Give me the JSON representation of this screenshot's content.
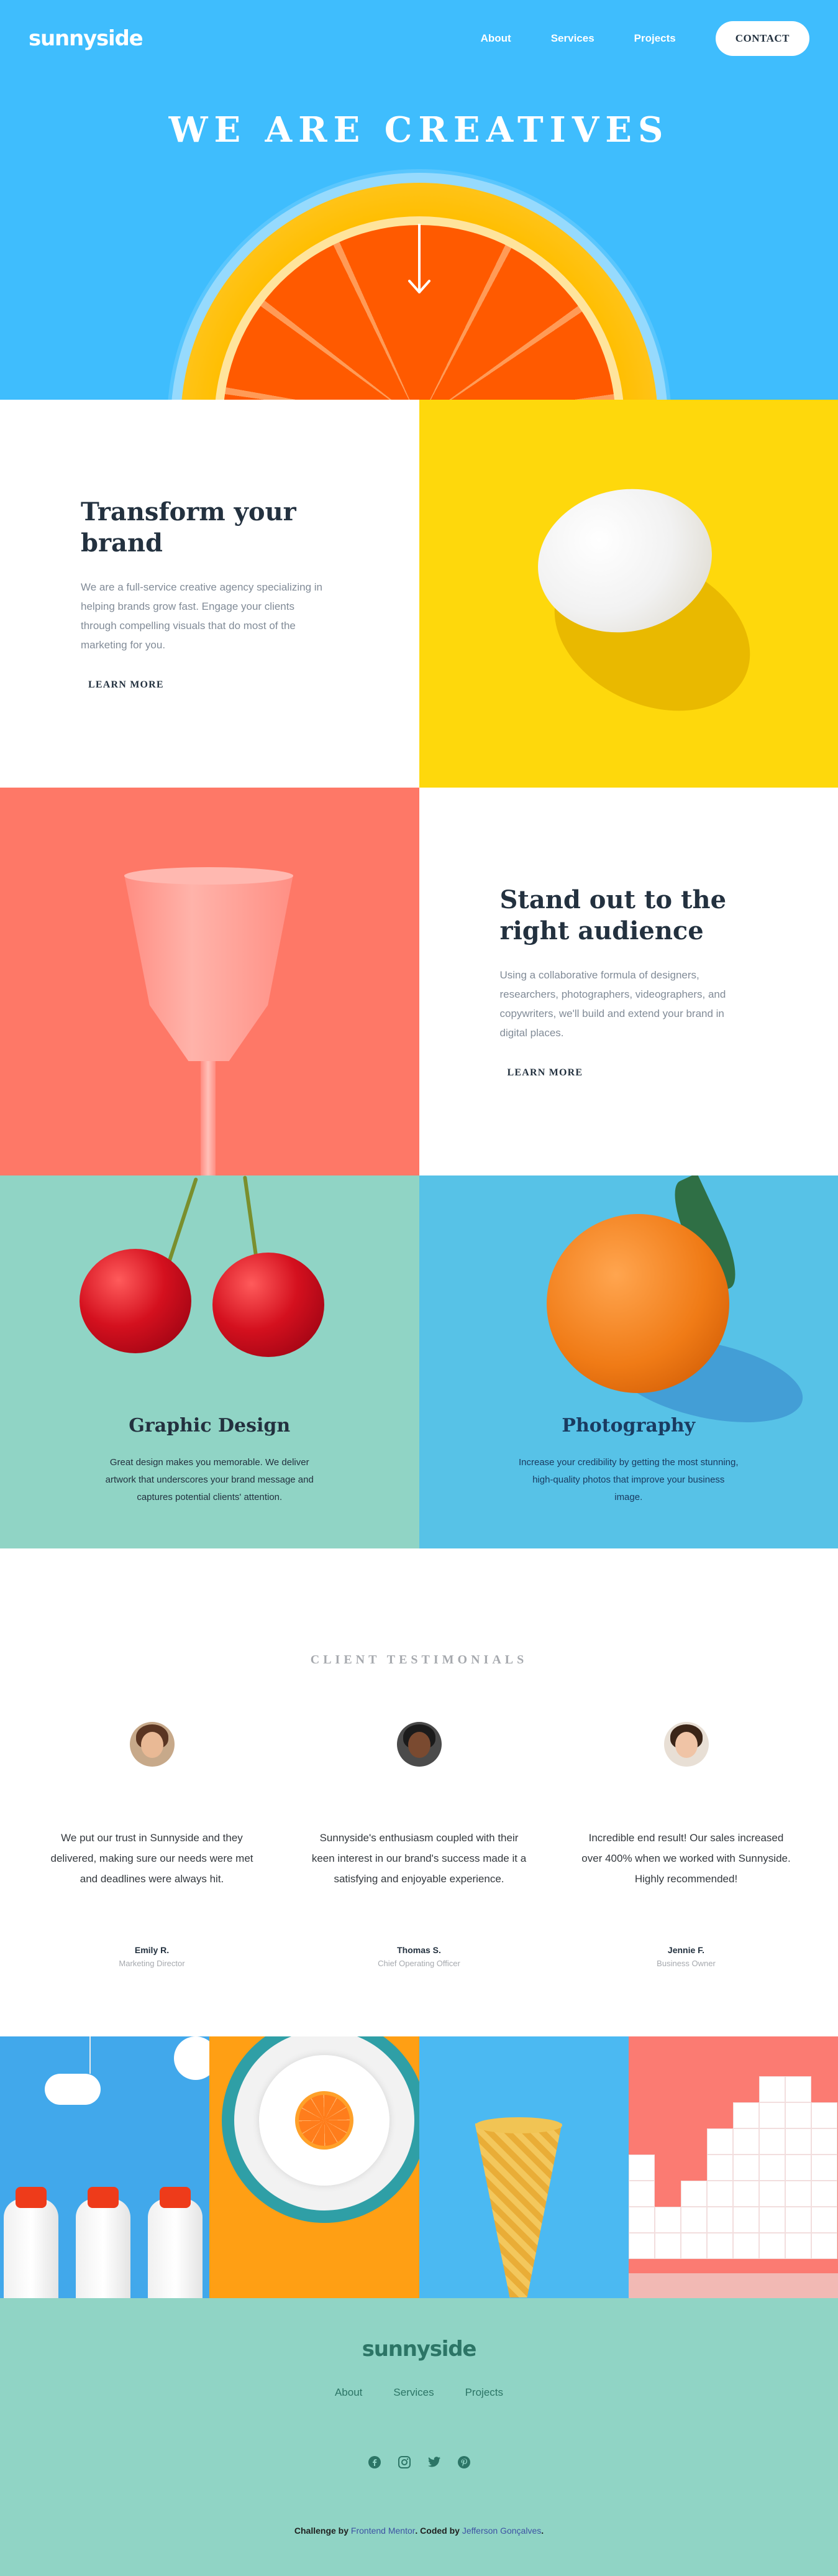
{
  "header": {
    "logo": "sunnyside",
    "nav": [
      "About",
      "Services",
      "Projects"
    ],
    "cta": "CONTACT"
  },
  "hero": {
    "title": "WE ARE CREATIVES",
    "scroll_icon": "arrow-down-icon"
  },
  "features": [
    {
      "title": "Transform your brand",
      "body": "We are a full-service creative agency specializing in helping brands grow fast. Engage your clients through compelling visuals that do most of the marketing for you.",
      "link": "LEARN MORE",
      "accent": "#fad400"
    },
    {
      "title": "Stand out to the right audience",
      "body": "Using a collaborative formula of designers, researchers, photographers, videographers, and copywriters, we'll build and extend your brand in digital places.",
      "link": "LEARN MORE",
      "accent": "#fe7a6c"
    }
  ],
  "services": [
    {
      "title": "Graphic Design",
      "body": "Great design makes you memorable. We deliver artwork that underscores your brand message and captures potential clients' attention."
    },
    {
      "title": "Photography",
      "body": "Increase your credibility by getting the most stunning, high-quality photos that improve your business image."
    }
  ],
  "testimonials": {
    "heading": "CLIENT TESTIMONIALS",
    "items": [
      {
        "quote": "We put our trust in Sunnyside and they delivered, making sure our needs were met and deadlines were always hit.",
        "name": "Emily R.",
        "role": "Marketing Director"
      },
      {
        "quote": "Sunnyside's enthusiasm coupled with their keen interest in our brand's success made it a satisfying and enjoyable experience.",
        "name": "Thomas S.",
        "role": "Chief Operating Officer"
      },
      {
        "quote": "Incredible end result! Our sales increased over 400% when we worked with Sunnyside. Highly recommended!",
        "name": "Jennie F.",
        "role": "Business Owner"
      }
    ]
  },
  "footer": {
    "logo": "sunnyside",
    "nav": [
      "About",
      "Services",
      "Projects"
    ],
    "socials": [
      "facebook-icon",
      "instagram-icon",
      "twitter-icon",
      "pinterest-icon"
    ],
    "attribution": {
      "challenge_label": "Challenge by",
      "challenge_link": "Frontend Mentor",
      "coded_label": ". Coded by",
      "coded_link": "Jefferson Gonçalves",
      "end": "."
    }
  },
  "colors": {
    "hero_bg": "#3fbdfd",
    "egg_bg": "#fed80c",
    "glass_bg": "#fe7867",
    "graphic_bg": "#90d4c5",
    "photo_bg": "#57c2e7",
    "footer_bg": "#90d4c5"
  }
}
